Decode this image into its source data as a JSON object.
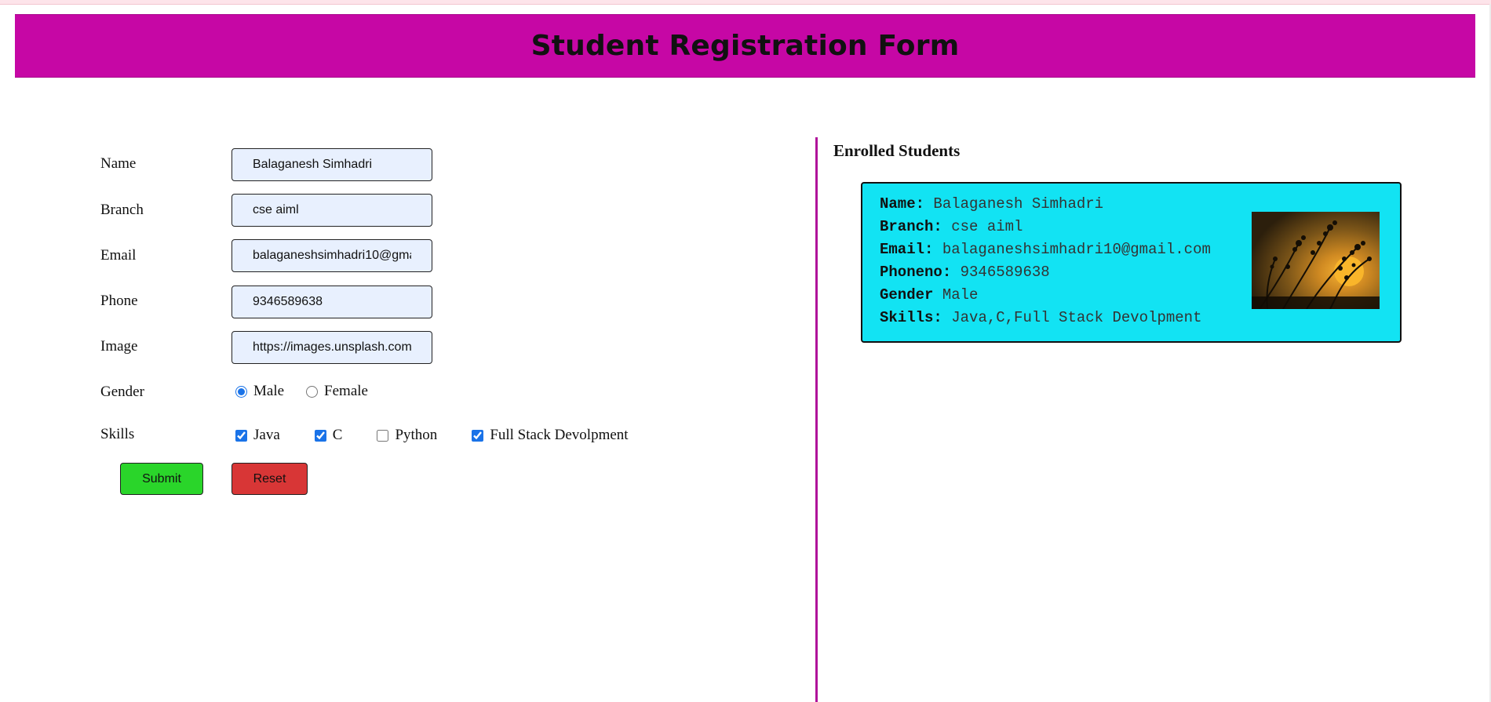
{
  "header": {
    "title": "Student Registration Form"
  },
  "form": {
    "fields": [
      {
        "label": "Name",
        "value": "Balaganesh Simhadri"
      },
      {
        "label": "Branch",
        "value": "cse aiml"
      },
      {
        "label": "Email",
        "value": "balaganeshsimhadri10@gmail.com"
      },
      {
        "label": "Phone",
        "value": "9346589638"
      },
      {
        "label": "Image",
        "value": "https://images.unsplash.com"
      }
    ],
    "gender": {
      "label": "Gender",
      "options": [
        {
          "label": "Male",
          "checked": true
        },
        {
          "label": "Female",
          "checked": false
        }
      ]
    },
    "skills": {
      "label": "Skills",
      "options": [
        {
          "label": "Java",
          "checked": true
        },
        {
          "label": "C",
          "checked": true
        },
        {
          "label": "Python",
          "checked": false
        },
        {
          "label": "Full Stack Devolpment",
          "checked": true
        }
      ]
    },
    "submit_label": "Submit",
    "reset_label": "Reset"
  },
  "enrolled": {
    "title": "Enrolled Students",
    "students": [
      {
        "name_key": "Name:",
        "name": "Balaganesh Simhadri",
        "branch_key": "Branch:",
        "branch": "cse aiml",
        "email_key": "Email:",
        "email": "balaganeshsimhadri10@gmail.com",
        "phone_key": "Phoneno:",
        "phone": "9346589638",
        "gender_key": "Gender",
        "gender": "Male",
        "skills_key": "Skills:",
        "skills": "Java,C,Full Stack Devolpment",
        "image": "sunset-plant-silhouette-photo"
      }
    ]
  },
  "colors": {
    "header_bg": "#c607a5",
    "divider": "#b0139a",
    "card_bg": "#12e3f3",
    "submit_bg": "#2ad52a",
    "reset_bg": "#d83636",
    "input_bg": "#e8f0fe"
  }
}
